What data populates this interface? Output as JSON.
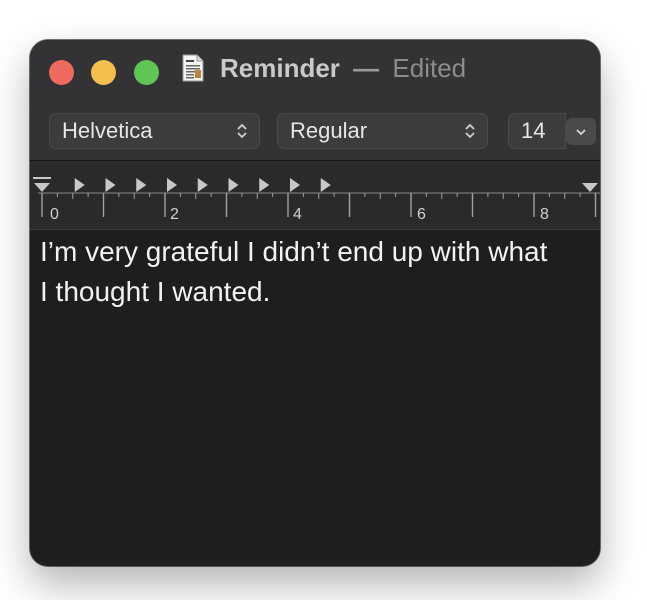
{
  "window": {
    "title": "Reminder",
    "separator": "—",
    "status": "Edited"
  },
  "toolbar": {
    "font_family": "Helvetica",
    "font_style": "Regular",
    "font_size": "14"
  },
  "ruler": {
    "labels": [
      "0",
      "2",
      "4",
      "6",
      "8"
    ]
  },
  "document": {
    "text": "I’m very grateful I didn’t end up with what I thought I wanted."
  },
  "colors": {
    "close": "#ee6a5f",
    "minimize": "#f5bf4f",
    "zoom": "#61c555",
    "window_bg": "#1e1e1e",
    "titlebar_bg": "#333335"
  },
  "icons": {
    "document": "document-icon",
    "select_chevron": "up-down-chevron-icon",
    "stepper": "chevron-down-icon",
    "tab_stop": "tab-stop-icon"
  }
}
